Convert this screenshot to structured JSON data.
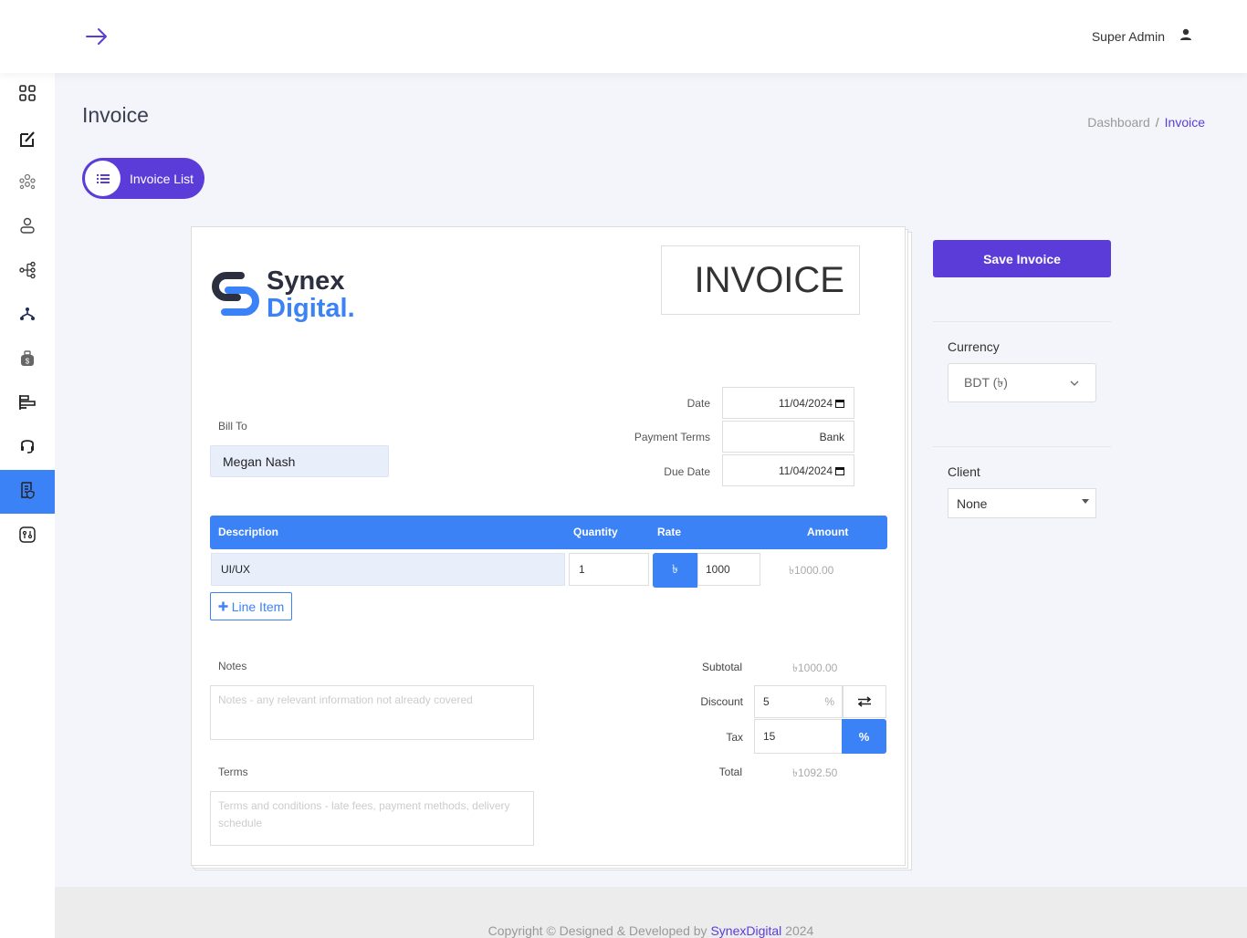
{
  "header": {
    "user_name": "Super Admin"
  },
  "sidebar": {
    "items": [
      {
        "icon": "dashboard-grid-icon"
      },
      {
        "icon": "edit-icon"
      },
      {
        "icon": "users-group-icon"
      },
      {
        "icon": "user-icon"
      },
      {
        "icon": "hierarchy-icon"
      },
      {
        "icon": "sitemap-icon"
      },
      {
        "icon": "money-bag-icon"
      },
      {
        "icon": "align-icon"
      },
      {
        "icon": "headphones-icon"
      },
      {
        "icon": "invoice-icon",
        "active": true
      },
      {
        "icon": "settings-icon"
      }
    ]
  },
  "page": {
    "title": "Invoice",
    "breadcrumb": {
      "home": "Dashboard",
      "separator": "/",
      "current": "Invoice"
    },
    "list_button": "Invoice List"
  },
  "invoice": {
    "brand_line1": "Synex",
    "brand_line2": "Digital.",
    "doc_title": "INVOICE",
    "bill_to_label": "Bill To",
    "bill_to_value": "Megan Nash",
    "date_label": "Date",
    "date_value": "11/04/2024",
    "payment_terms_label": "Payment Terms",
    "payment_terms_value": "Bank",
    "due_date_label": "Due Date",
    "due_date_value": "11/04/2024",
    "table_headers": {
      "description": "Description",
      "quantity": "Quantity",
      "rate": "Rate",
      "amount": "Amount"
    },
    "line_items": [
      {
        "description": "UI/UX",
        "quantity": "1",
        "currency_symbol": "৳",
        "rate": "1000",
        "amount": "৳1000.00"
      }
    ],
    "add_line_label": "Line Item",
    "notes_label": "Notes",
    "notes_placeholder": "Notes - any relevant information not already covered",
    "terms_label": "Terms",
    "terms_placeholder": "Terms and conditions - late fees, payment methods, delivery schedule",
    "subtotal_label": "Subtotal",
    "subtotal_value": "৳1000.00",
    "discount_label": "Discount",
    "discount_value": "5",
    "discount_unit": "%",
    "tax_label": "Tax",
    "tax_value": "15",
    "tax_unit": "%",
    "total_label": "Total",
    "total_value": "৳1092.50"
  },
  "side_panel": {
    "save_label": "Save Invoice",
    "currency_label": "Currency",
    "currency_value": "BDT (৳)",
    "client_label": "Client",
    "client_value": "None"
  },
  "footer": {
    "prefix": "Copyright © Designed & Developed by",
    "brand": "SynexDigital",
    "year": "2024"
  },
  "colors": {
    "primary": "#5b3cd9",
    "accent": "#3b82f6",
    "background": "#f4f5fa"
  }
}
